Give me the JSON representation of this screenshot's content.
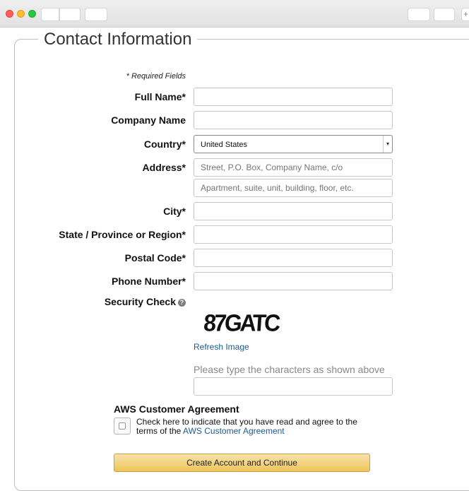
{
  "section_title": "Contact Information",
  "required_note": "* Required Fields",
  "fields": {
    "full_name": {
      "label": "Full Name*",
      "value": "",
      "placeholder": ""
    },
    "company_name": {
      "label": "Company Name",
      "value": "",
      "placeholder": ""
    },
    "country": {
      "label": "Country*",
      "selected": "United States"
    },
    "address": {
      "label": "Address*",
      "placeholder1": "Street, P.O. Box, Company Name, c/o",
      "placeholder2": "Apartment, suite, unit, building, floor, etc."
    },
    "city": {
      "label": "City*",
      "value": ""
    },
    "state": {
      "label": "State / Province or Region*",
      "value": ""
    },
    "postal_code": {
      "label": "Postal Code*",
      "value": ""
    },
    "phone": {
      "label": "Phone Number*",
      "value": ""
    }
  },
  "security": {
    "label": "Security Check",
    "captcha_text": "87GATC",
    "refresh_label": "Refresh Image",
    "hint": "Please type the characters as shown above",
    "answer": ""
  },
  "agreement": {
    "title": "AWS Customer Agreement",
    "text_before": "Check here to indicate that you have read and agree to the terms of the ",
    "link": "AWS Customer Agreement",
    "checked": false
  },
  "submit_label": "Create Account and Continue",
  "icons": {
    "help": "question-circle-icon",
    "select_arrow": "chevron-down-icon",
    "tab_add": "plus-icon"
  },
  "colors": {
    "button_top": "#f8e3ad",
    "button_bottom": "#eec55a",
    "link": "#1a5a96"
  }
}
